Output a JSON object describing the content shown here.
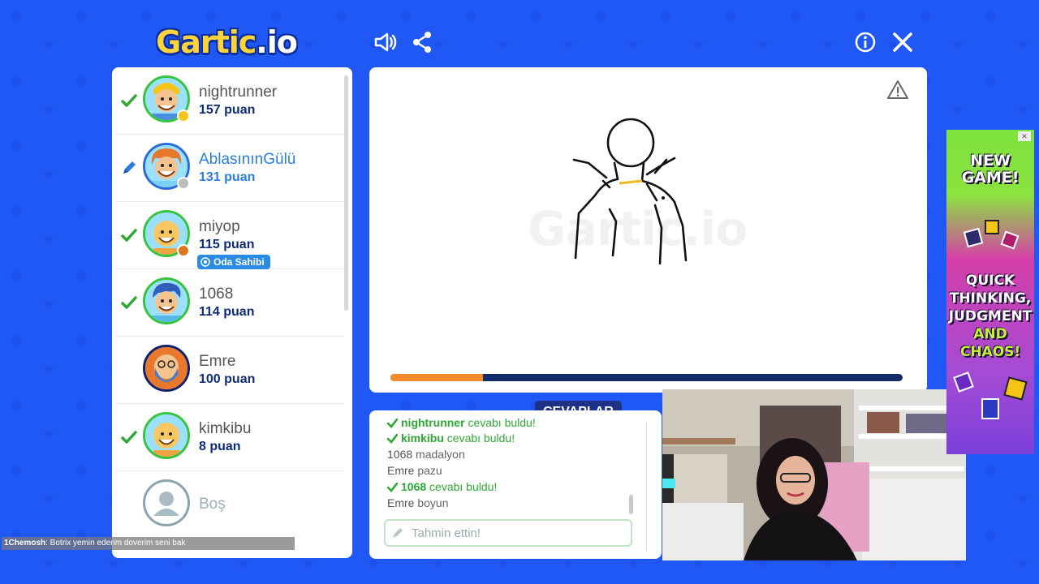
{
  "header": {
    "logo_main": "Gartic",
    "logo_suffix": ".io"
  },
  "players": [
    {
      "name": "nightrunner",
      "score": "157 puan",
      "status": "guessed",
      "dot": "#f5c518"
    },
    {
      "name": "AblasınınGülü",
      "score": "131 puan",
      "status": "drawing",
      "dot": "#bdbdbd"
    },
    {
      "name": "miyop",
      "score": "115 puan",
      "status": "guessed",
      "dot": "#e0741d",
      "badge": "Oda Sahibi"
    },
    {
      "name": "1068",
      "score": "114 puan",
      "status": "guessed"
    },
    {
      "name": "Emre",
      "score": "100 puan",
      "status": "none"
    },
    {
      "name": "kimkibu",
      "score": "8 puan",
      "status": "guessed"
    },
    {
      "name": "Boş",
      "status": "empty"
    }
  ],
  "canvas": {
    "watermark": "Gartic.io",
    "timer_fraction": 0.18
  },
  "answers": {
    "tab_label": "CEVAPLAR",
    "messages": [
      {
        "user": "nightrunner",
        "text": "cevabı buldu!",
        "type": "found"
      },
      {
        "user": "kimkibu",
        "text": "cevabı buldu!",
        "type": "found"
      },
      {
        "user": "1068",
        "text": "madalyon",
        "type": "guess"
      },
      {
        "user": "Emre",
        "text": "pazu",
        "type": "guess"
      },
      {
        "user": "1068",
        "text": "cevabı buldu!",
        "type": "found"
      },
      {
        "user": "Emre",
        "text": "boyun",
        "type": "guess"
      }
    ],
    "input_placeholder": "Tahmin ettin!"
  },
  "ad": {
    "headline": "NEW GAME!",
    "tagline_white": "QUICK THINKING, JUDGMENT",
    "tagline_green": "AND CHAOS!"
  },
  "chat_overlay": {
    "user": "1Chemosh",
    "message": ": Botrix yemin ederim doverim seni bak"
  },
  "colors": {
    "background": "#1f58f5",
    "accent_green": "#37c43d",
    "navy": "#0f2b68",
    "timer": "#f48a2c"
  }
}
